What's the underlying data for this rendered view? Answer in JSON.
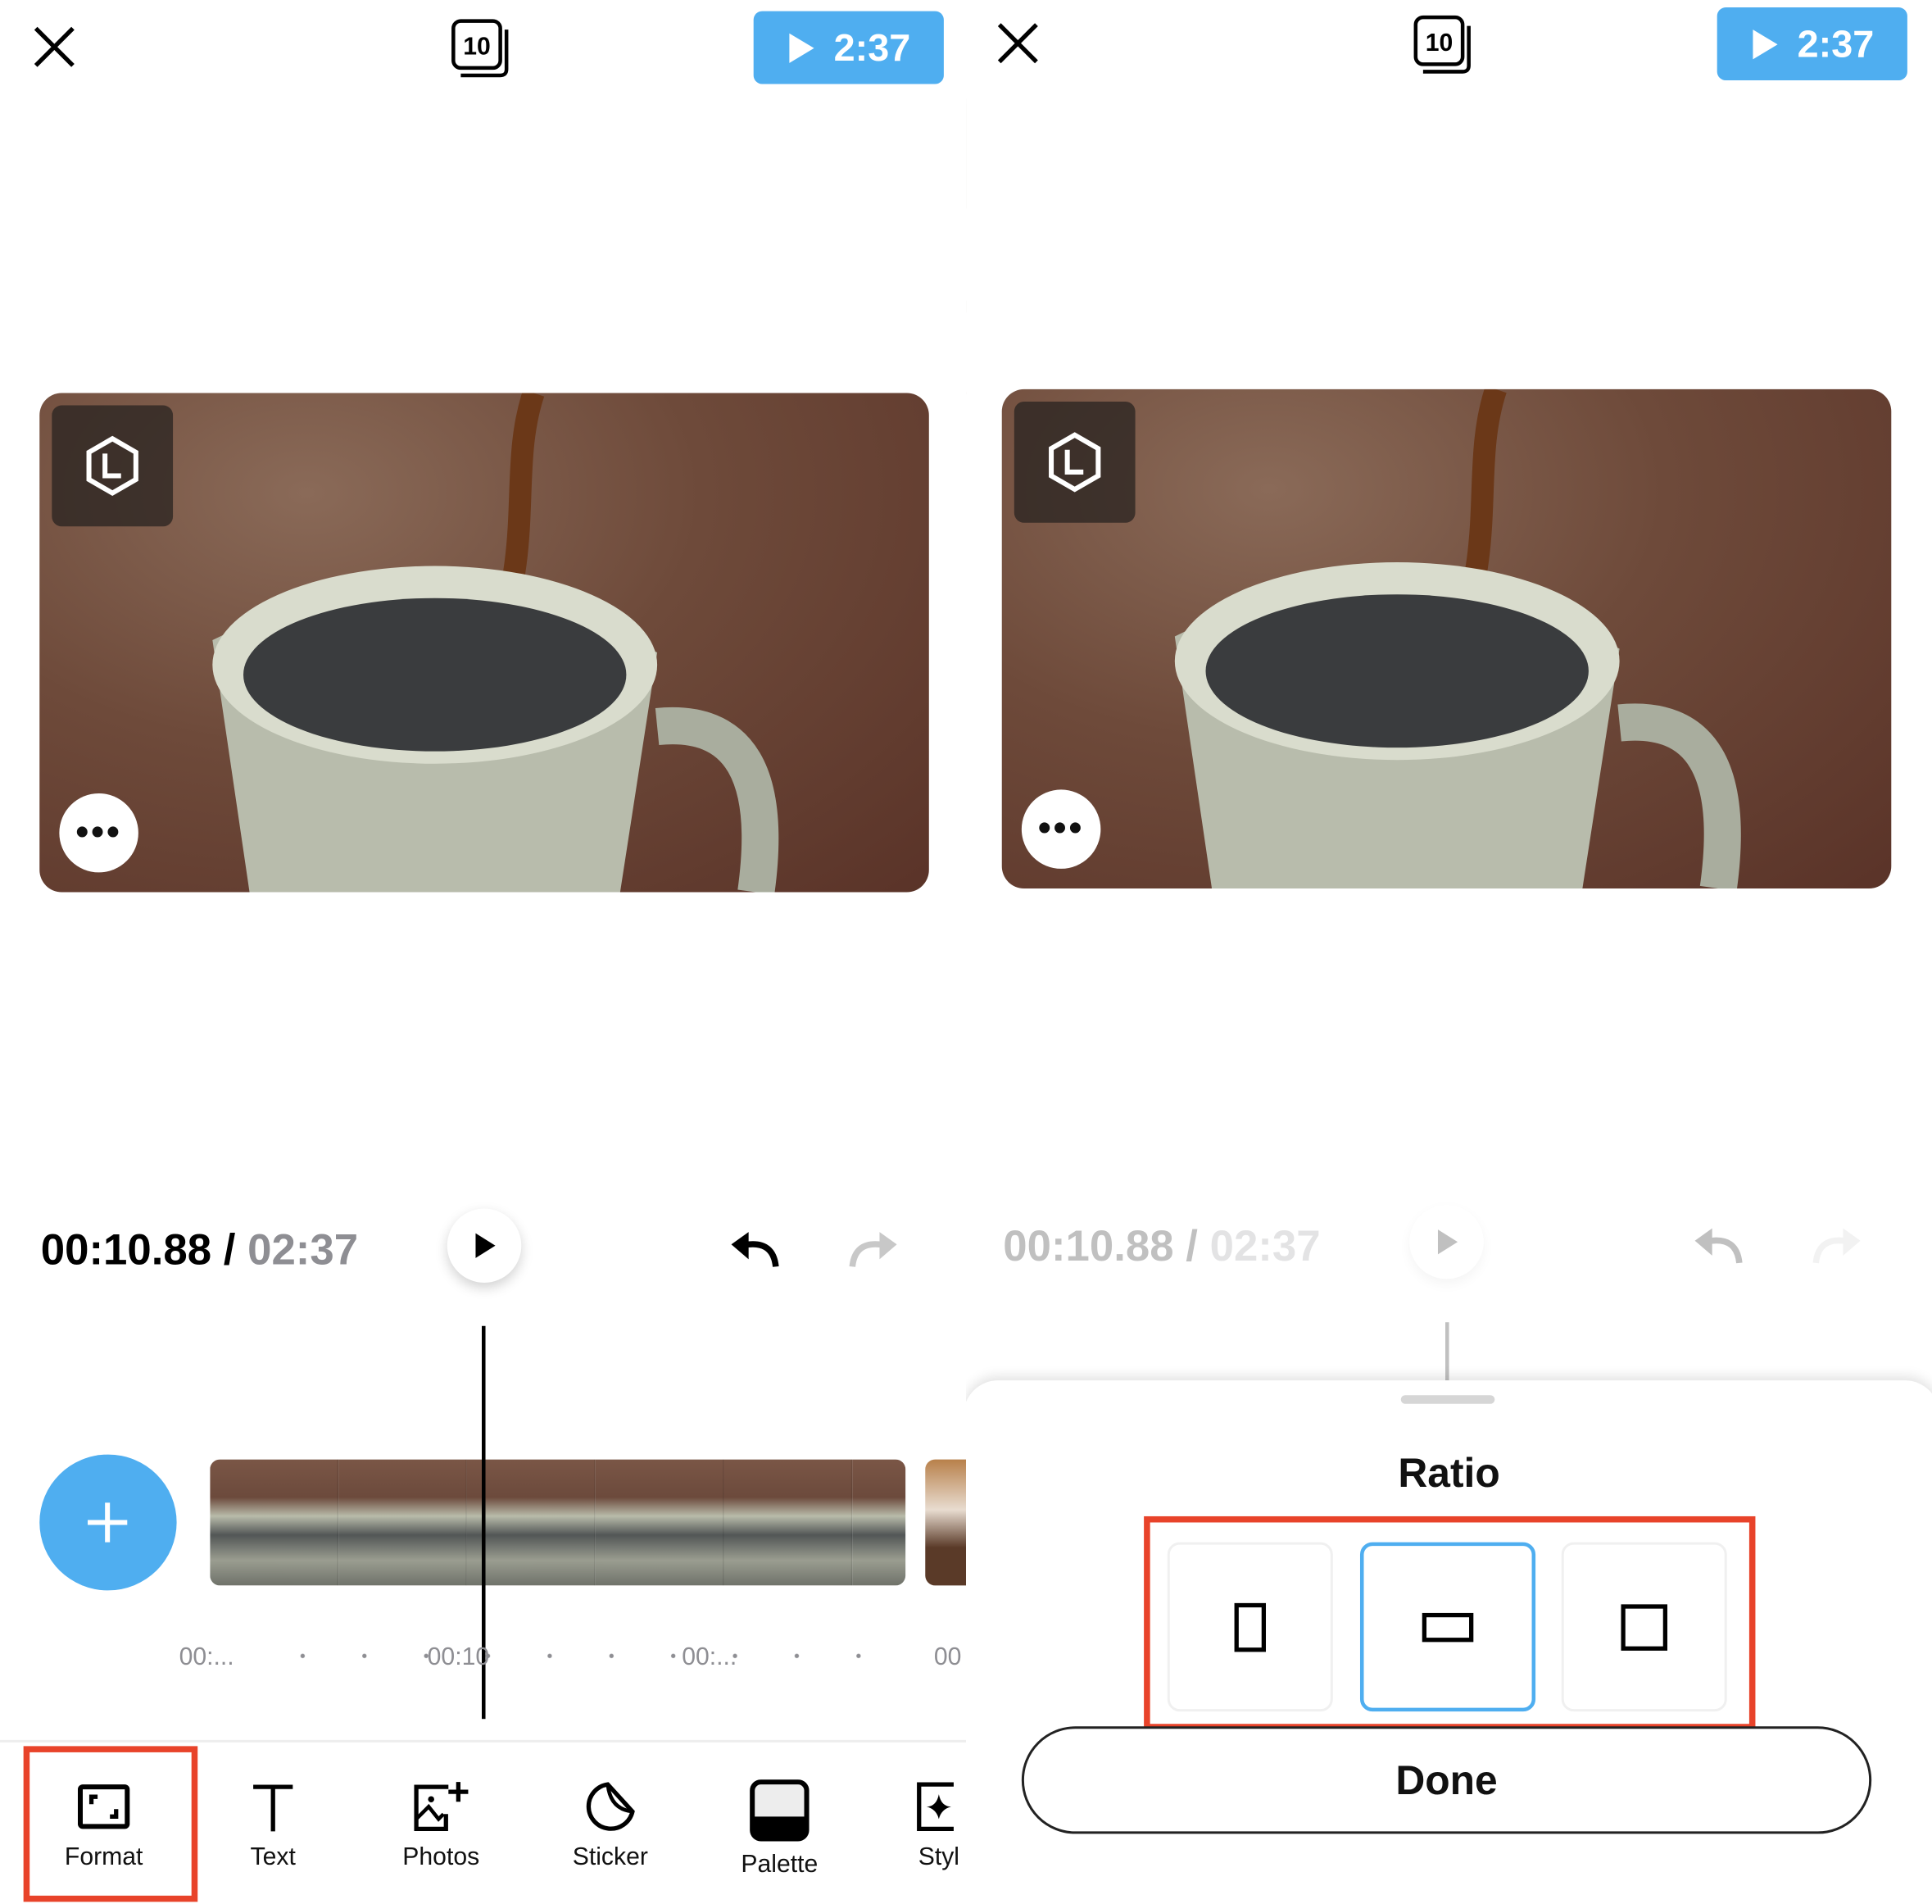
{
  "colors": {
    "accent": "#4FAEF0",
    "highlight": "#E8432A"
  },
  "left": {
    "preview_button": "2:37",
    "current_time": "00:10.88",
    "separator": "/",
    "total_time": "02:37",
    "more_label": "•••",
    "ticks": [
      "00:...",
      "00:10",
      "00:...",
      "00"
    ],
    "toolbar": [
      {
        "label": "Format",
        "icon": "aspect-ratio-icon"
      },
      {
        "label": "Text",
        "icon": "text-icon"
      },
      {
        "label": "Photos",
        "icon": "add-photo-icon"
      },
      {
        "label": "Sticker",
        "icon": "sticker-icon"
      },
      {
        "label": "Palette",
        "icon": "palette-icon"
      },
      {
        "label": "Styl",
        "icon": "style-icon"
      }
    ]
  },
  "right": {
    "preview_button": "2:37",
    "current_time": "00:10.88",
    "separator": "/",
    "total_time": "02:37",
    "more_label": "•••",
    "sheet": {
      "title": "Ratio",
      "options": [
        "portrait",
        "landscape",
        "square"
      ],
      "selected": "landscape",
      "done_label": "Done"
    }
  }
}
